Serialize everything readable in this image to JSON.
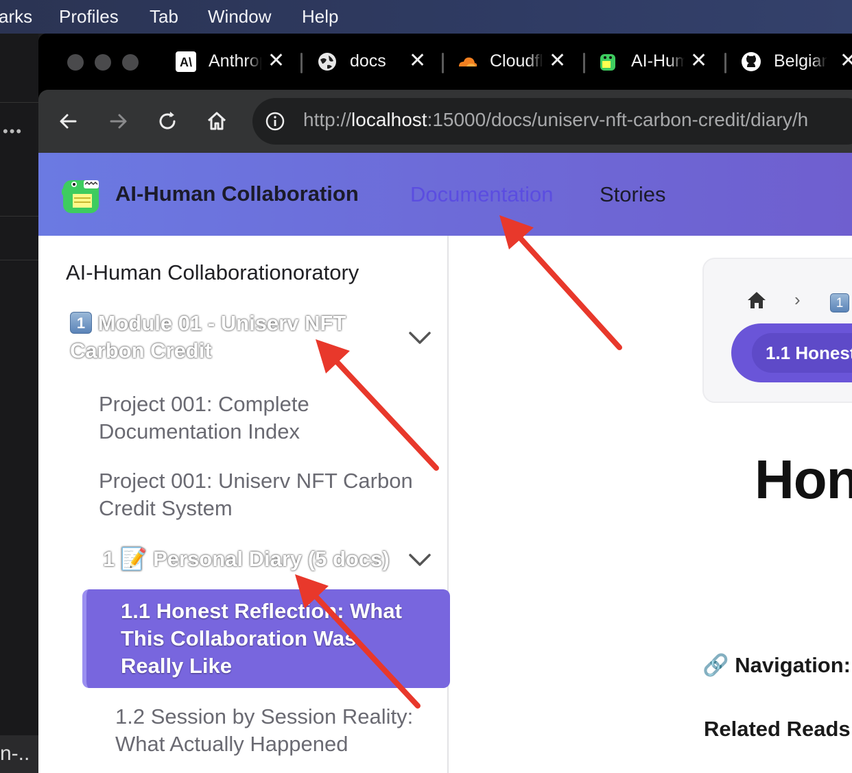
{
  "menubar": {
    "items": [
      "arks",
      "Profiles",
      "Tab",
      "Window",
      "Help"
    ]
  },
  "background_app": {
    "dots": "•••",
    "terminal_text": "n-.."
  },
  "browser": {
    "tabs": [
      {
        "title": "Anthropic",
        "icon": "anthropic-logo"
      },
      {
        "title": "docs",
        "icon": "globe-icon"
      },
      {
        "title": "Cloudflare",
        "icon": "cloudflare-logo"
      },
      {
        "title": "AI-Human Collaboration",
        "icon": "docusaurus-dino-icon"
      },
      {
        "title": "Belgian",
        "icon": "github-icon"
      }
    ],
    "tab_close_glyph": "✕",
    "url": {
      "scheme": "http://",
      "host": "localhost",
      "rest": ":15000/docs/uniserv-nft-carbon-credit/diary/h"
    }
  },
  "site": {
    "brand": "AI-Human Collaboration",
    "nav": {
      "documentation": "Documentation",
      "stories": "Stories"
    },
    "accent_color": "#6d6bd8"
  },
  "sidebar": {
    "title": "AI-Human Collaborationoratory",
    "category": {
      "badge": "1",
      "label": "Module 01 - Uniserv NFT Carbon Credit"
    },
    "links": [
      "Project 001: Complete Documentation Index",
      "Project 001: Uniserv NFT Carbon Credit System"
    ],
    "subcategory": "1 📝 Personal Diary (5 docs)",
    "active_item": "1.1 Honest Reflection: What This Collaboration Was Really Like",
    "next_item": "1.2 Session by Session Reality: What Actually Happened"
  },
  "main": {
    "breadcrumb": {
      "separator": "›",
      "badge": "1",
      "current": "1.1 Honest"
    },
    "heading": "Hon",
    "navigation_label": "🔗 Navigation:",
    "related_label": "Related Reads"
  }
}
